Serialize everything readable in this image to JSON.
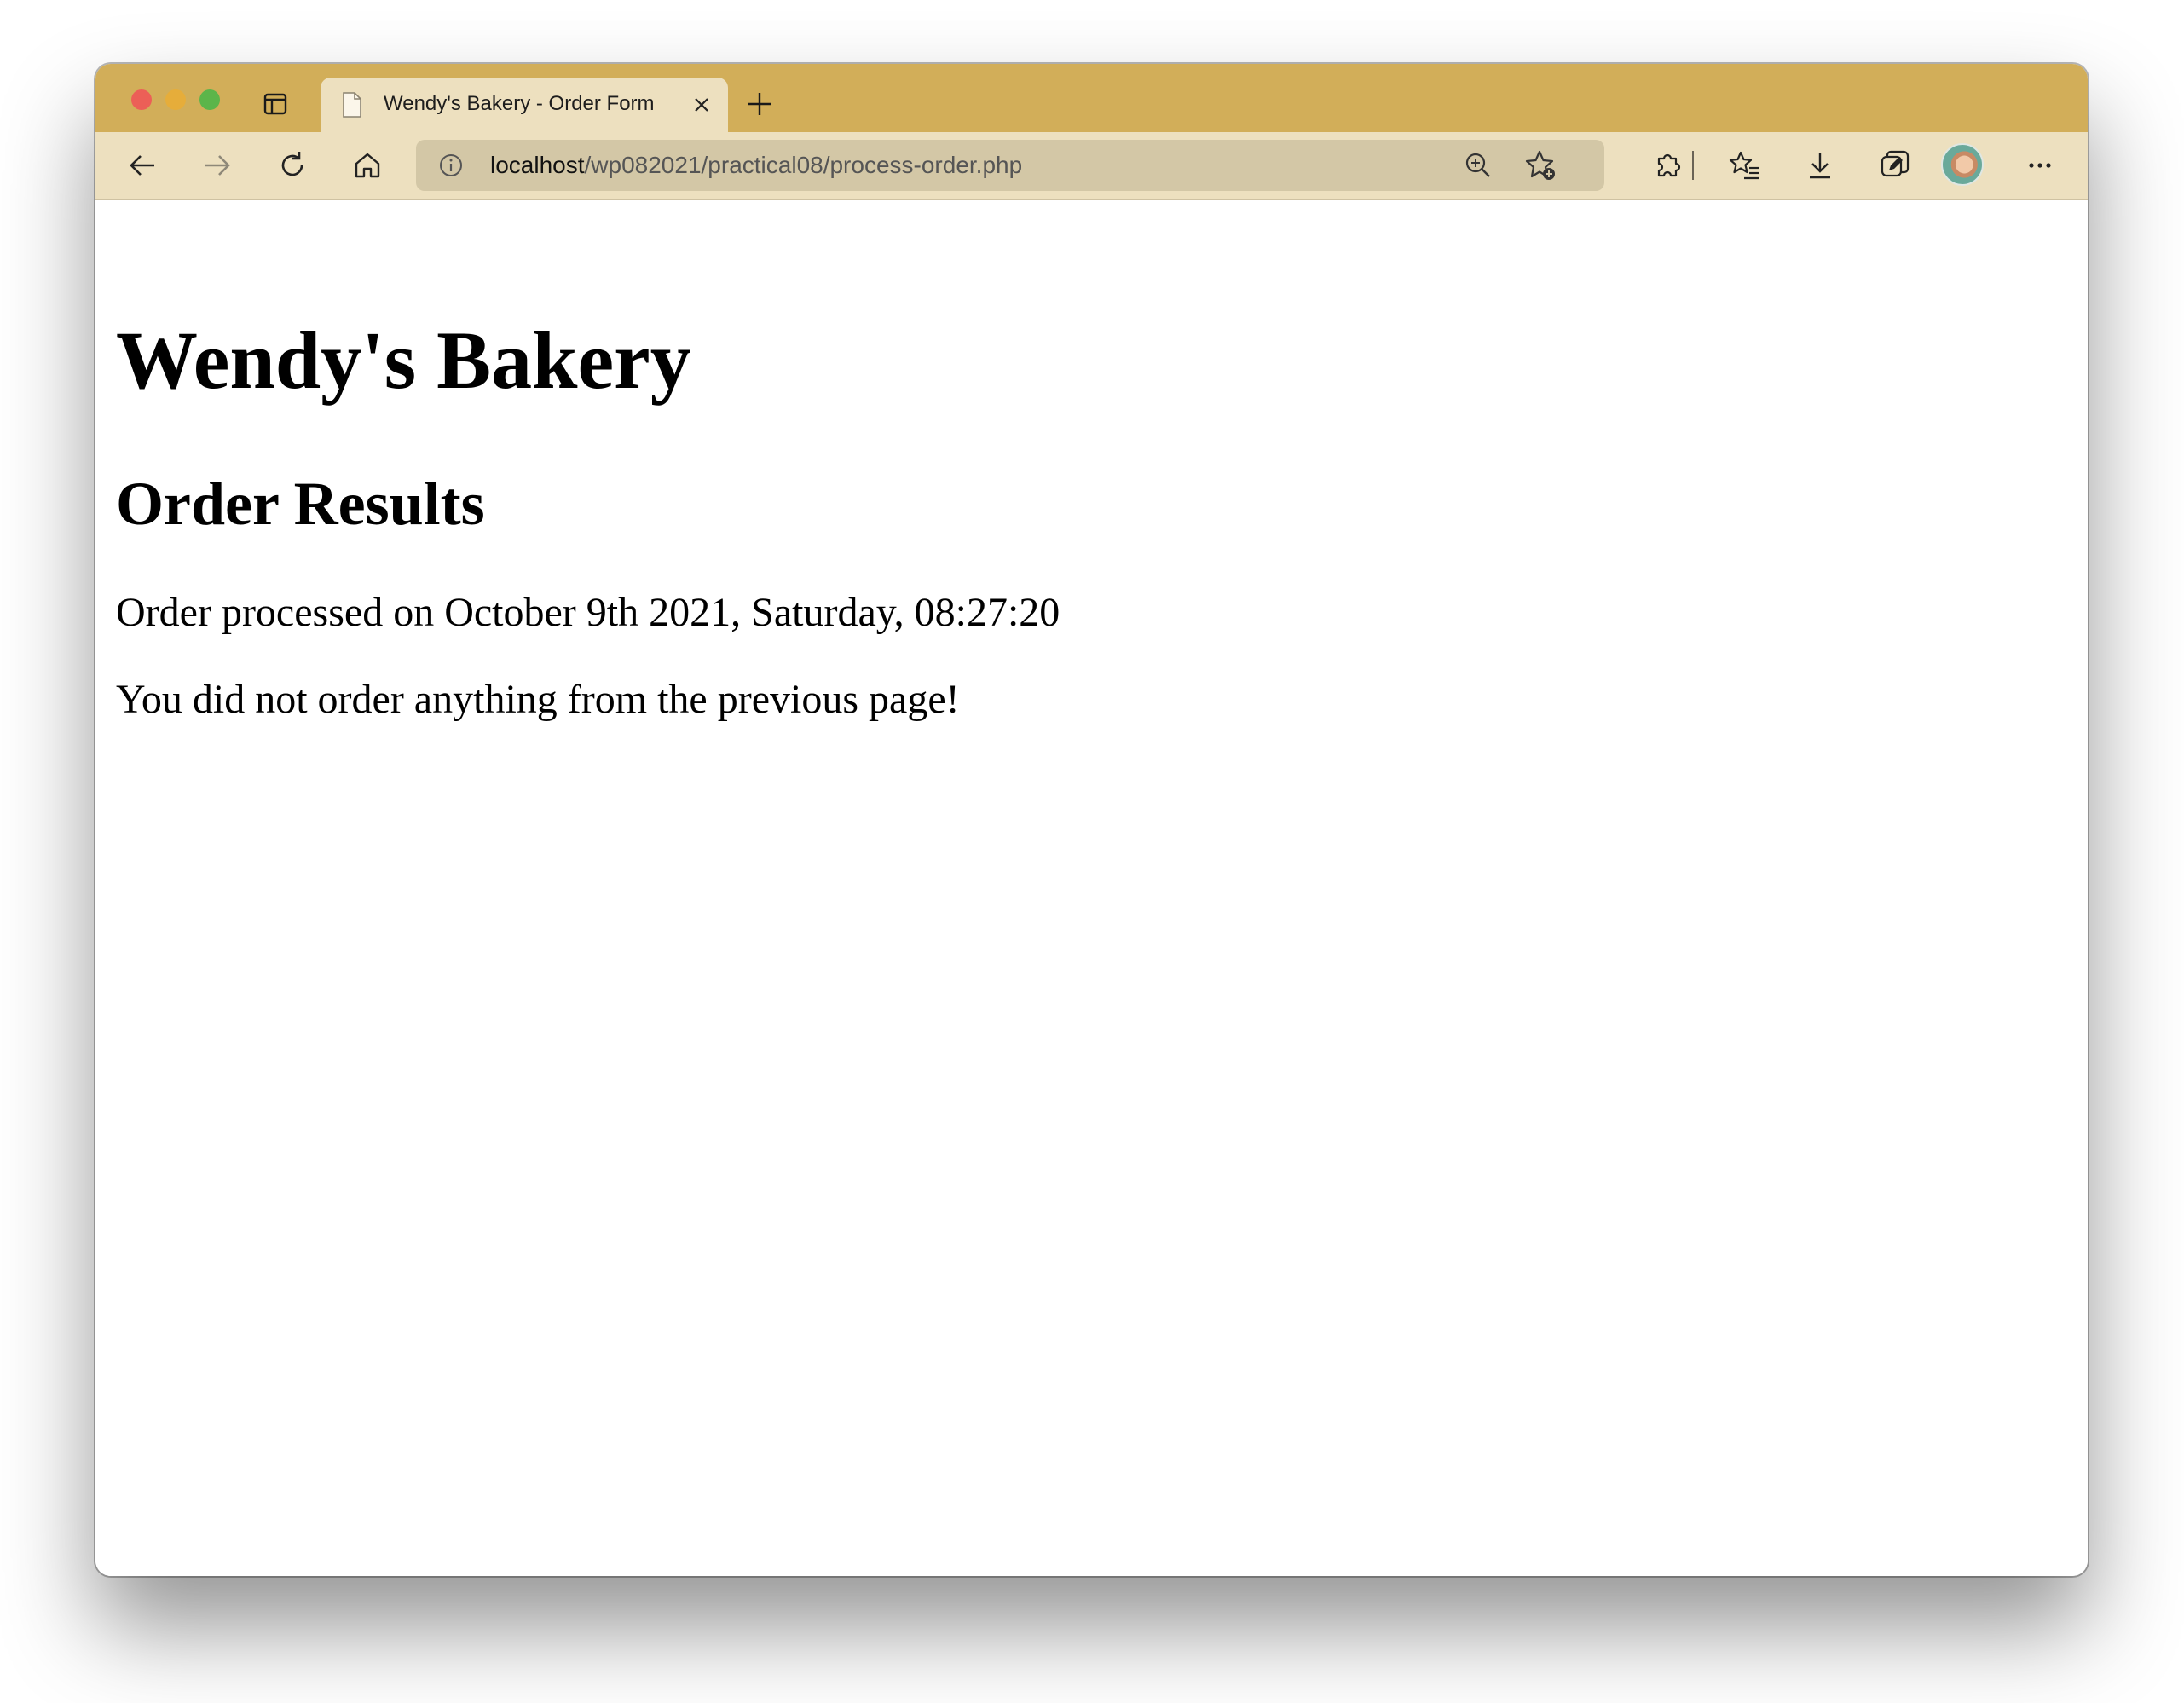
{
  "browser": {
    "tab": {
      "title": "Wendy's Bakery - Order Form"
    },
    "address_bar": {
      "host": "localhost",
      "path": "/wp082021/practical08/process-order.php"
    },
    "icons": {
      "sidebar": "tab-actions-icon",
      "favicon": "page-icon",
      "close": "close-icon",
      "new_tab": "plus-icon",
      "back": "arrow-left-icon",
      "forward": "arrow-right-icon",
      "refresh": "refresh-icon",
      "home": "home-icon",
      "info": "info-icon",
      "zoom": "zoom-in-icon",
      "add_favorite": "star-add-icon",
      "extensions": "puzzle-icon",
      "favorites": "favorites-list-icon",
      "downloads": "download-icon",
      "collections": "collections-icon",
      "profile": "avatar",
      "more": "more-icon"
    },
    "colors": {
      "tab_strip": "#d2ae59",
      "toolbar": "#ede0bf",
      "omnibox": "#d3c7a6"
    }
  },
  "page": {
    "heading": "Wendy's Bakery",
    "subheading": "Order Results",
    "processed_text": "Order processed on October 9th 2021, Saturday, 08:27:20",
    "message": "You did not order anything from the previous page!"
  }
}
